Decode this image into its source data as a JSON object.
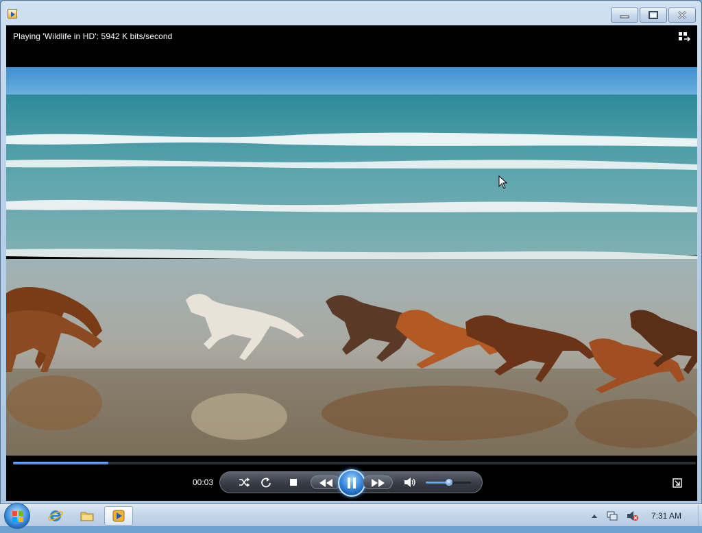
{
  "window": {
    "status_text": "Playing 'Wildlife in HD': 5942 K bits/second"
  },
  "playback": {
    "time": "00:03",
    "progress": 0.14,
    "volume": 0.52,
    "state": "playing"
  },
  "controls": {
    "buttons": [
      "shuffle-icon",
      "repeat-icon",
      "stop-icon",
      "previous-icon",
      "pause-icon",
      "next-icon",
      "volume-icon"
    ]
  },
  "taskbar": {
    "items": [
      "start-orb-icon",
      "internet-explorer-icon",
      "windows-explorer-icon",
      "windows-media-player-icon"
    ],
    "active_item": "windows-media-player-icon",
    "tray_icons": [
      "show-hidden-icons-icon",
      "network-icon",
      "volume-muted-icon"
    ],
    "clock": "7:31 AM"
  },
  "colors": {
    "accent": "#3b78d8",
    "window_frame": "#b9d1ea",
    "taskbar": "#c4d6ea"
  }
}
